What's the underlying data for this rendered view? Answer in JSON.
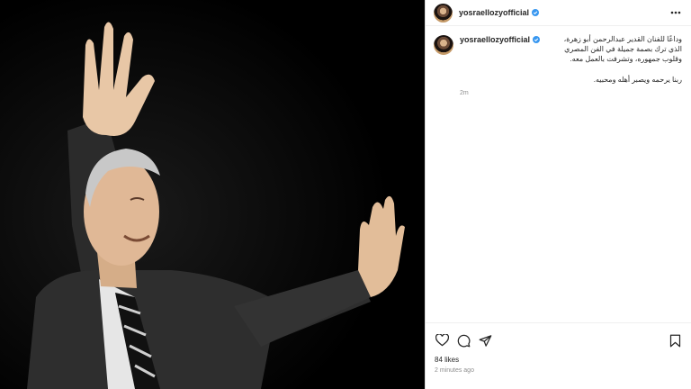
{
  "photo": {
    "subject": "man-waving-on-stage"
  },
  "post": {
    "username": "yosraellozyofficial",
    "verified": true,
    "caption_line1": "وداعًا للفنان القدير عبدالرحمن أبو زهرة، الذي ترك بصمة جميلة في الفن المصري وقلوب جمهوره، وتشرفت بالعمل معه.",
    "caption_line2": "ربنا يرحمه ويصبر أهله ومحبيه.",
    "comment_time": "2m",
    "likes": "84 likes",
    "time": "2 minutes ago"
  },
  "icons": {
    "more": "more-horizontal-icon",
    "like": "heart-icon",
    "comment": "comment-icon",
    "share": "share-icon",
    "save": "bookmark-icon",
    "verified": "verified-badge-icon"
  },
  "colors": {
    "verified": "#3897f0",
    "text": "#262626",
    "muted": "#8e8e8e",
    "border": "#dbdbdb"
  }
}
